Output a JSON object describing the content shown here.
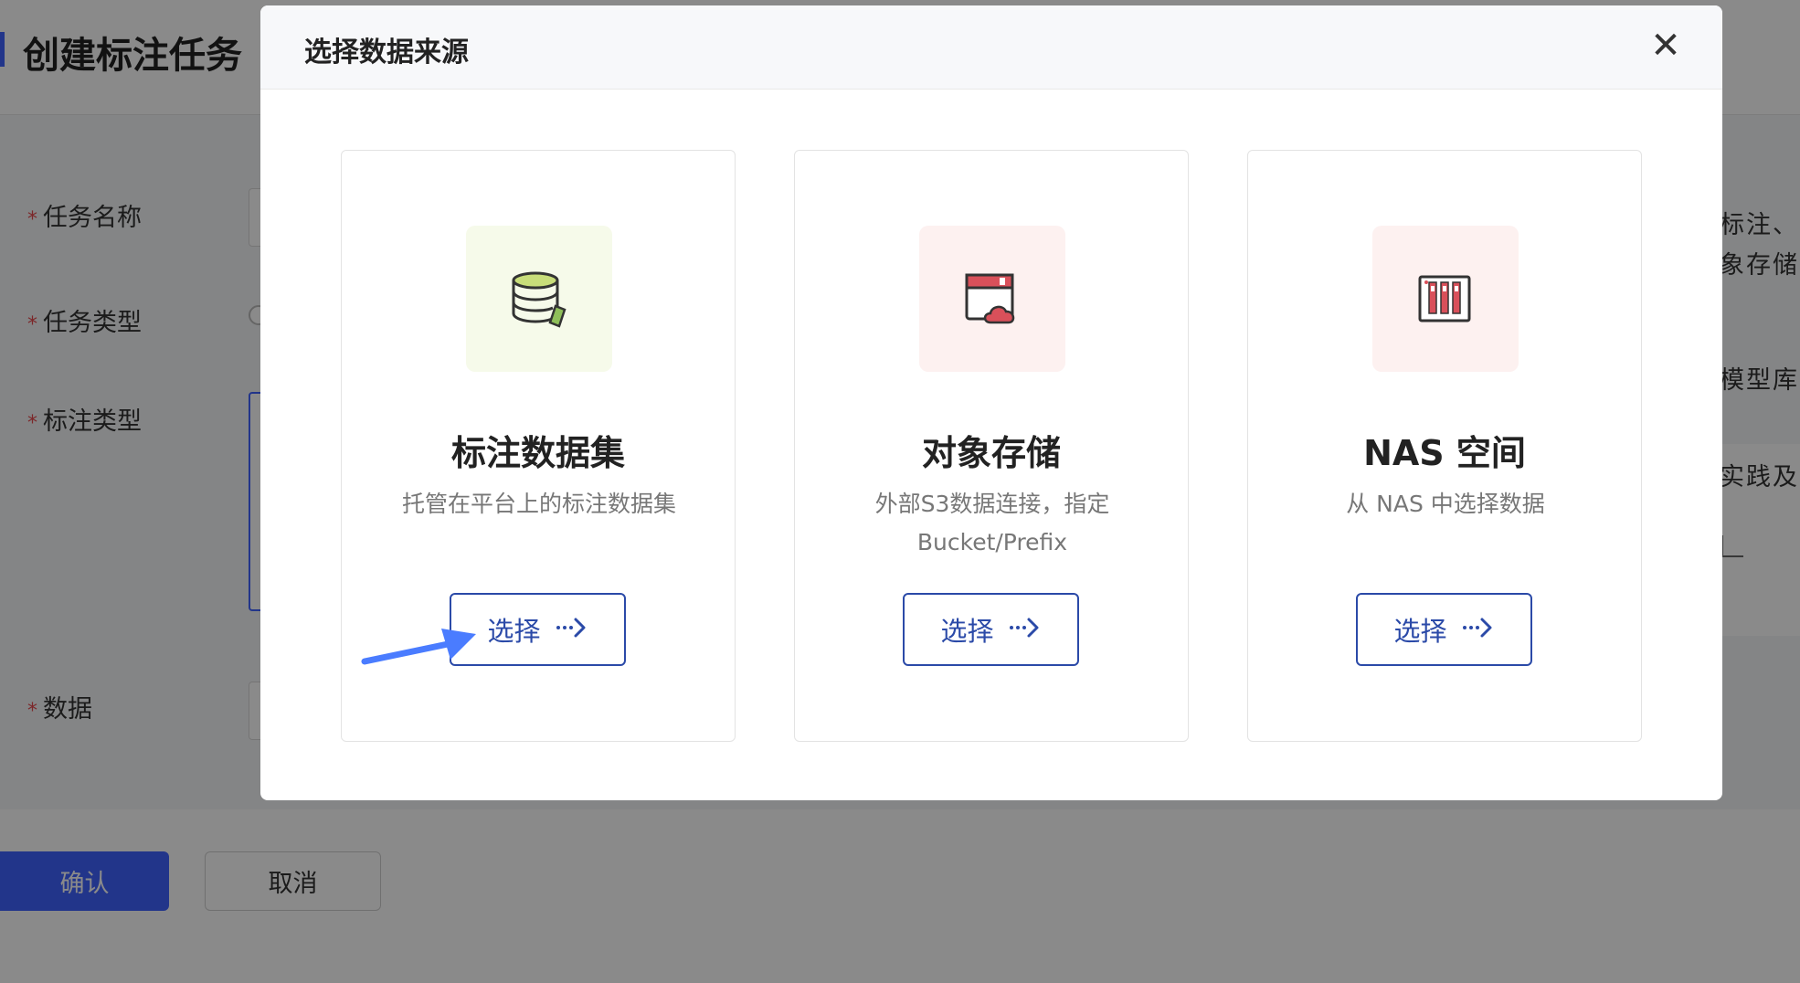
{
  "background": {
    "page_title": "创建标注任务",
    "form": {
      "task_name_label": "任务名称",
      "task_type_label": "任务类型",
      "annotation_type_label": "标注类型",
      "data_label": "数据",
      "required_mark": "*"
    },
    "side_texts": [
      "标注、",
      "象存储",
      "模型库",
      "实践及"
    ],
    "confirm_label": "确认",
    "cancel_label": "取消"
  },
  "modal": {
    "title": "选择数据来源",
    "close_glyph": "✕",
    "cards": [
      {
        "title": "标注数据集",
        "description": "托管在平台上的标注数据集",
        "button_label": "选择",
        "icon": "database-edit-icon",
        "icon_bg": "#f6faea"
      },
      {
        "title": "对象存储",
        "description": "外部S3数据连接，指定Bucket/Prefix",
        "button_label": "选择",
        "icon": "cloud-storage-icon",
        "icon_bg": "#fdf1f0"
      },
      {
        "title": "NAS 空间",
        "description": "从 NAS 中选择数据",
        "button_label": "选择",
        "icon": "nas-server-icon",
        "icon_bg": "#fdf1f0"
      }
    ]
  },
  "colors": {
    "primary": "#3f63ff",
    "button_border": "#2b4aa8",
    "annotation_arrow": "#4a7cff"
  }
}
